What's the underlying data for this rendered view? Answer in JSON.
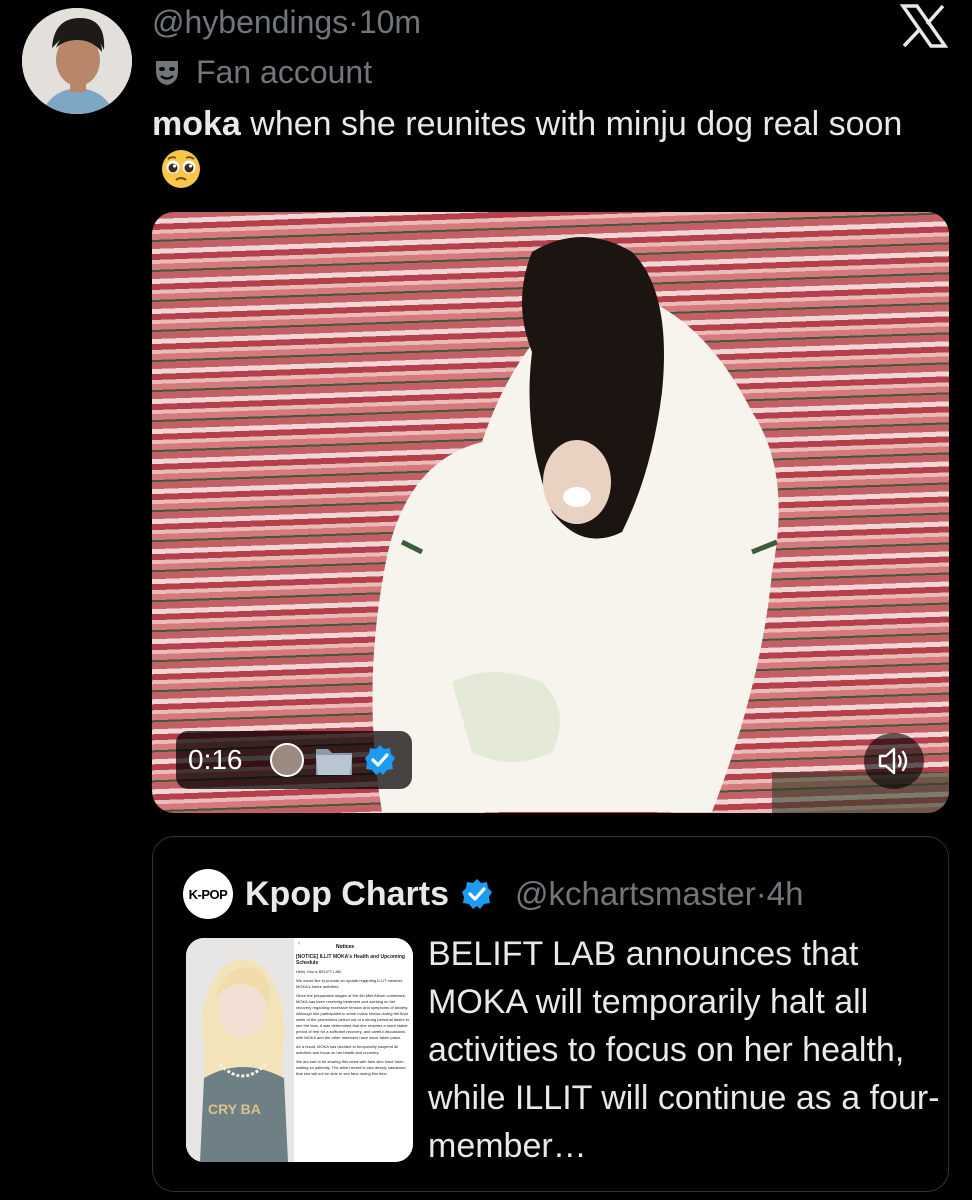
{
  "tweet": {
    "handle": "@hybendings",
    "separator": "·",
    "time": "10m",
    "label_icon": "theater-masks-icon",
    "label": "Fan account",
    "text_bold": "moka",
    "text_rest": " when she reunites with minju dog real soon",
    "emoji": "pleading-face-emoji"
  },
  "media": {
    "duration": "0:16",
    "badges": [
      "avatar-icon",
      "folder-icon",
      "verified-badge-icon"
    ],
    "mute_icon": "speaker-icon"
  },
  "quote": {
    "logo_text": "K-POP",
    "name": "Kpop Charts",
    "verified_icon": "verified-badge-icon",
    "handle": "@kchartsmaster",
    "separator": "·",
    "time": "4h",
    "text": "BELIFT LAB announces that MOKA will temporarily halt all activities to focus on her health, while ILLIT will continue as a four-member…",
    "notice_title": "Notices",
    "notice_headline": "[NOTICE] ILLIT MOKA's Health and Upcoming Schedule",
    "notice_body": [
      "Hello, this is BELIFT LAB.",
      "We would like to provide an update regarding ILLIT member MOKA's future activities.",
      "Since the preparation stages of the 4th Mini Album comeback, MOKA has been receiving treatment and working on her recovery regarding excessive tension and symptoms of anxiety. Although she participated in some music shows during the final week of the promotions period out of a strong personal desire to see the fans, it was determined that she requires a more stable period of rest for a sufficient recovery, and careful discussions with MOKA and the other members have since taken place.",
      "As a result, MOKA has decided to temporarily suspend all activities and focus on her health and recovery.",
      "We are sad to be sharing this news with fans who have been waiting so patiently. The artist herself is also deeply saddened that she will not be able to see fans during this time."
    ],
    "shirt_text": "CRY BA"
  },
  "colors": {
    "background": "#000000",
    "text": "#e7e9ea",
    "muted": "#71767b",
    "verified": "#1d9bf0",
    "border": "#2f3336"
  }
}
